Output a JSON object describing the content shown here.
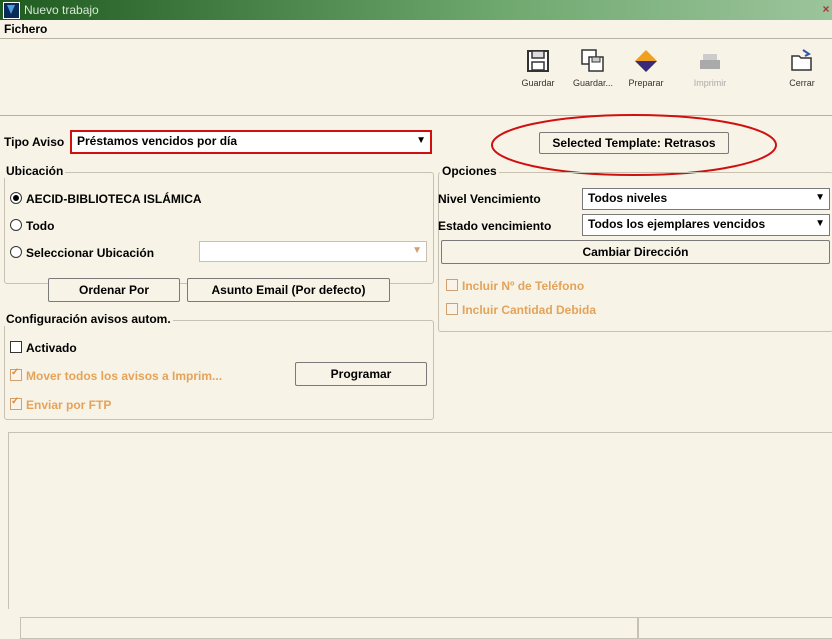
{
  "window": {
    "title": "Nuevo trabajo"
  },
  "menu": {
    "fichero": "Fichero"
  },
  "toolbar": {
    "items": [
      {
        "label": "Guardar",
        "icon": "save-icon"
      },
      {
        "label": "Guardar...",
        "icon": "save-as-icon"
      },
      {
        "label": "Preparar",
        "icon": "diamond-icon"
      },
      {
        "label": "Imprimir",
        "icon": "print-icon"
      },
      {
        "label": "Cerrar",
        "icon": "close-folder-icon"
      }
    ]
  },
  "tipo_aviso": {
    "label": "Tipo Aviso",
    "value": "Préstamos vencidos por día"
  },
  "selected_template": "Selected Template: Retrasos",
  "ubicacion": {
    "title": "Ubicación",
    "options": [
      "AECID-BIBLIOTECA ISLÁMICA",
      "Todo",
      "Seleccionar Ubicación"
    ],
    "selected_index": 0
  },
  "buttons": {
    "ordenar": "Ordenar Por",
    "asunto": "Asunto Email (Por defecto)",
    "programar": "Programar",
    "cambiar": "Cambiar Dirección"
  },
  "config": {
    "title": "Configuración avisos autom.",
    "activado": "Activado",
    "mover": "Mover todos los avisos a Imprim...",
    "enviar": "Enviar por FTP"
  },
  "opciones": {
    "title": "Opciones",
    "nivel_label": "Nivel Vencimiento",
    "nivel_value": "Todos niveles",
    "estado_label": "Estado vencimiento",
    "estado_value": "Todos los ejemplares vencidos",
    "incluir_tel": "Incluir Nº de Teléfono",
    "incluir_cant": "Incluir Cantidad Debida"
  },
  "colors": {
    "background": "#f7f3e6",
    "highlight_red": "#d01010",
    "disabled_orange": "#e5a35a"
  }
}
